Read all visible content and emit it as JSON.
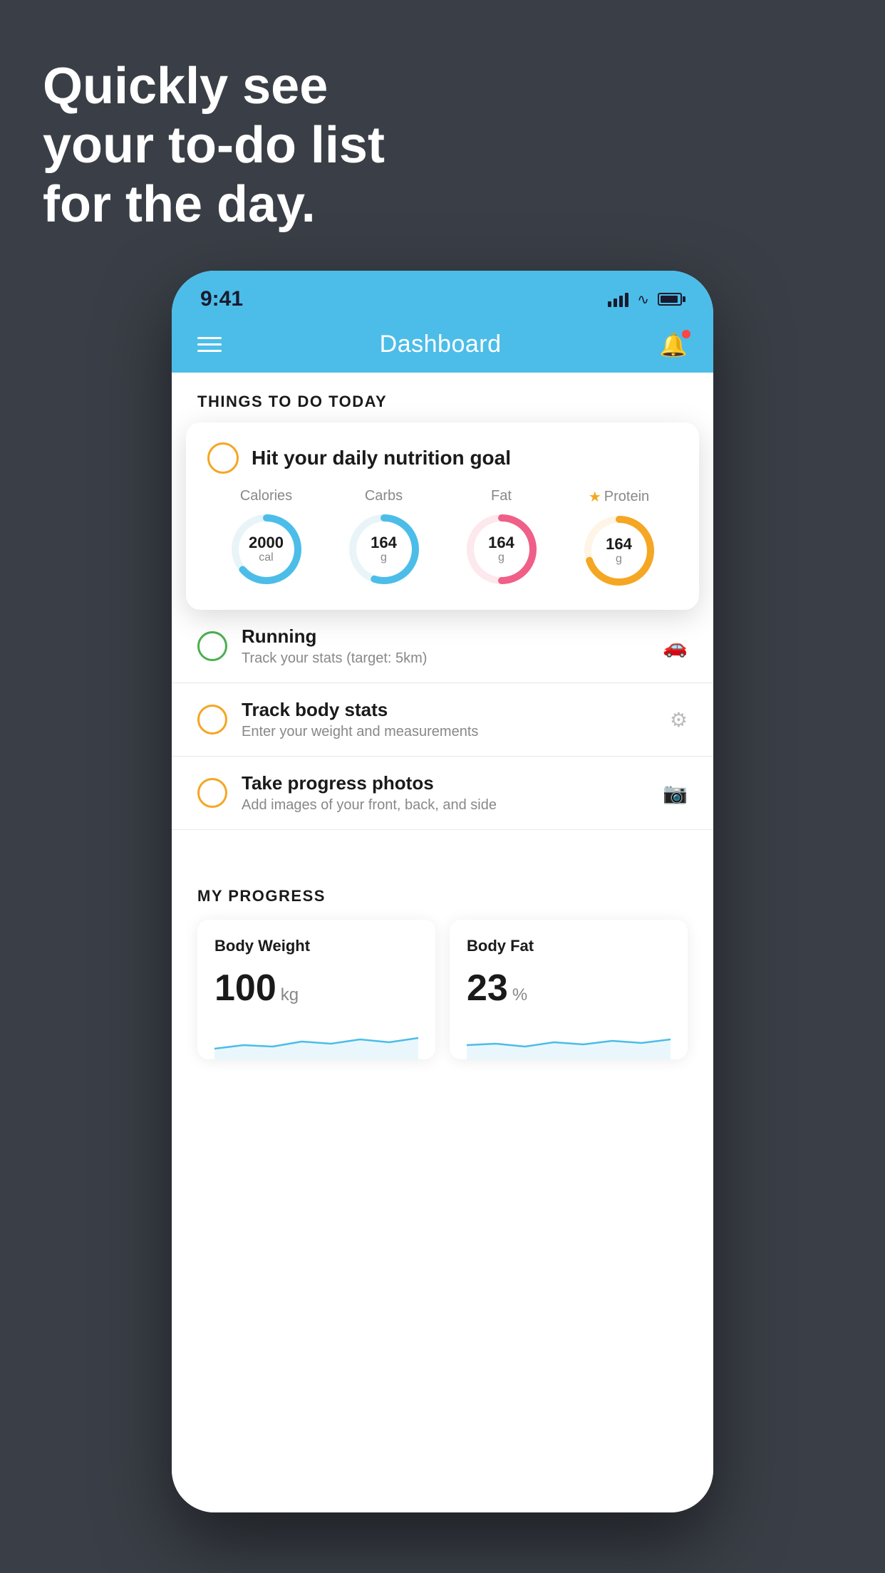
{
  "hero": {
    "line1": "Quickly see",
    "line2": "your to-do list",
    "line3": "for the day."
  },
  "status_bar": {
    "time": "9:41"
  },
  "nav": {
    "title": "Dashboard"
  },
  "section": {
    "things_today": "THINGS TO DO TODAY"
  },
  "featured_card": {
    "title": "Hit your daily nutrition goal",
    "nutrients": [
      {
        "label": "Calories",
        "value": "2000",
        "unit": "cal",
        "color": "#4cbde8",
        "percent": 65
      },
      {
        "label": "Carbs",
        "value": "164",
        "unit": "g",
        "color": "#4cbde8",
        "percent": 55
      },
      {
        "label": "Fat",
        "value": "164",
        "unit": "g",
        "color": "#ef5f87",
        "percent": 50
      },
      {
        "label": "Protein",
        "value": "164",
        "unit": "g",
        "color": "#f5a623",
        "percent": 70,
        "star": true
      }
    ]
  },
  "todo_items": [
    {
      "title": "Running",
      "subtitle": "Track your stats (target: 5km)",
      "check_color": "green",
      "icon": "shoe"
    },
    {
      "title": "Track body stats",
      "subtitle": "Enter your weight and measurements",
      "check_color": "yellow",
      "icon": "scale"
    },
    {
      "title": "Take progress photos",
      "subtitle": "Add images of your front, back, and side",
      "check_color": "yellow",
      "icon": "photo"
    }
  ],
  "progress": {
    "title": "MY PROGRESS",
    "cards": [
      {
        "title": "Body Weight",
        "value": "100",
        "unit": "kg"
      },
      {
        "title": "Body Fat",
        "value": "23",
        "unit": "%"
      }
    ]
  }
}
